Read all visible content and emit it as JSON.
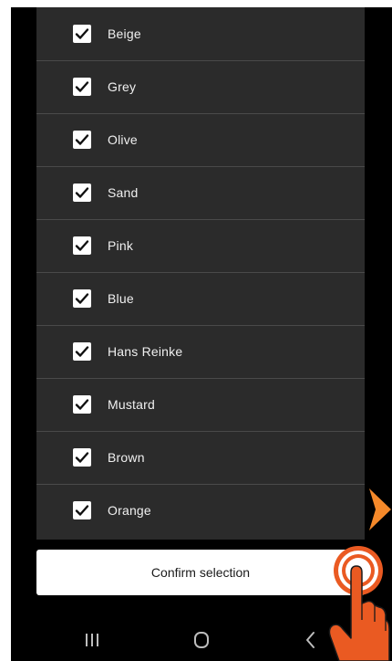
{
  "color_options": {
    "items": [
      {
        "label": "Beige",
        "checked": true
      },
      {
        "label": "Grey",
        "checked": true
      },
      {
        "label": "Olive",
        "checked": true
      },
      {
        "label": "Sand",
        "checked": true
      },
      {
        "label": "Pink",
        "checked": true
      },
      {
        "label": "Blue",
        "checked": true
      },
      {
        "label": "Hans Reinke",
        "checked": true
      },
      {
        "label": "Mustard",
        "checked": true
      },
      {
        "label": "Brown",
        "checked": true
      },
      {
        "label": "Orange",
        "checked": true
      }
    ]
  },
  "confirm_button": {
    "label": "Confirm selection"
  },
  "nav_bar": {
    "recent_icon": "recent-apps-icon",
    "home_icon": "home-icon",
    "back_icon": "back-icon"
  },
  "overlay": {
    "arrow_icon": "pointer-arrow-icon",
    "hand_icon": "tap-hand-icon"
  },
  "colors": {
    "list_background": "#2b2b2b",
    "screen_background": "#000000",
    "checkbox": "#ffffff",
    "accent_orange": "#f5892a",
    "hand_orange": "#ea5a22"
  }
}
